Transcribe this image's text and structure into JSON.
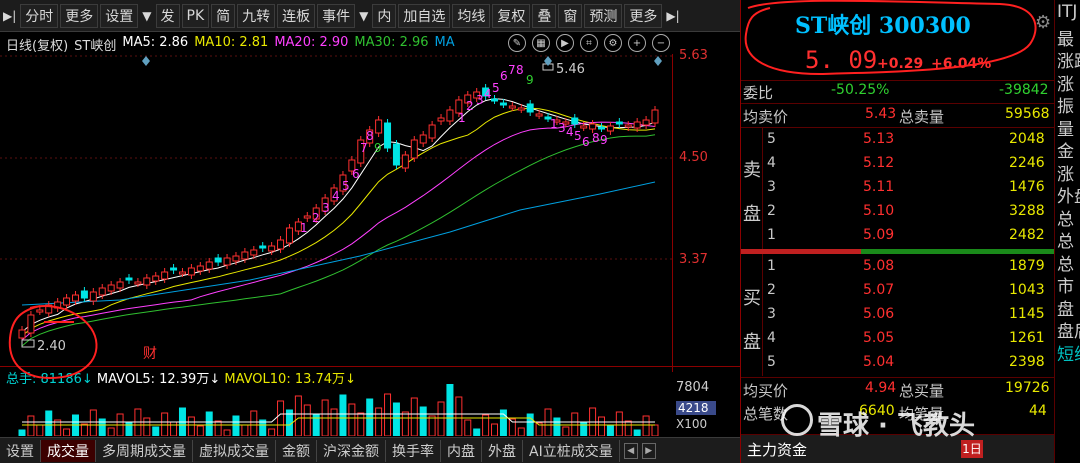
{
  "toolbar": {
    "items": [
      "分时",
      "更多",
      "设置",
      "发",
      "PK",
      "简",
      "九转",
      "连板",
      "事件",
      "内",
      "加自选",
      "均线",
      "复权",
      "叠",
      "窗",
      "预测",
      "更多"
    ]
  },
  "chart_header": {
    "period": "日线(复权)",
    "name": "ST峡创",
    "ma5": "MA5: 2.86",
    "ma10": "MA10: 2.81",
    "ma20": "MA20: 2.90",
    "ma30": "MA30: 2.96",
    "ma_more": "MA"
  },
  "price_axis": {
    "top": "5.63",
    "mid": "4.50",
    "low": "3.37"
  },
  "annotations": {
    "high": "5.46",
    "low": "2.40",
    "event": "财"
  },
  "volume": {
    "label": "总手: 81186",
    "mavol5": "MAVOL5: 12.39万",
    "mavol10": "MAVOL10: 13.74万",
    "axis_top": "7804",
    "axis_mid": "4218",
    "axis_unit": "X100"
  },
  "bottom_tabs": [
    "设置",
    "成交量",
    "多周期成交量",
    "虚拟成交量",
    "金额",
    "沪深金额",
    "换手率",
    "内盘",
    "外盘",
    "AI立桩成交量"
  ],
  "quote": {
    "title": "ST峡创 300300",
    "price": "5. 09",
    "change": "+0.29",
    "pct": "+6.04%",
    "weibi_label": "委比",
    "weibi_val": "-50.25%",
    "weicha_val": "-39842",
    "avg_sell_label": "均卖价",
    "avg_sell_val": "5.43",
    "total_sell_label": "总卖量",
    "total_sell_val": "59568",
    "avg_buy_label": "均买价",
    "avg_buy_val": "4.94",
    "total_buy_label": "总买量",
    "total_buy_val": "19726",
    "trades_label": "总笔数",
    "trades_val": "6640",
    "trades_vol_label": "均笔量",
    "trades_vol_val": "44",
    "sell_side": "卖盘",
    "buy_side": "买盘",
    "fund_label": "主力资金",
    "fund_btn": "1日"
  },
  "asks": [
    {
      "level": "5",
      "price": "5.13",
      "vol": "2048"
    },
    {
      "level": "4",
      "price": "5.12",
      "vol": "2246"
    },
    {
      "level": "3",
      "price": "5.11",
      "vol": "1476"
    },
    {
      "level": "2",
      "price": "5.10",
      "vol": "3288"
    },
    {
      "level": "1",
      "price": "5.09",
      "vol": "2482"
    }
  ],
  "bids": [
    {
      "level": "1",
      "price": "5.08",
      "vol": "1879"
    },
    {
      "level": "2",
      "price": "5.07",
      "vol": "1043"
    },
    {
      "level": "3",
      "price": "5.06",
      "vol": "1145"
    },
    {
      "level": "4",
      "price": "5.05",
      "vol": "1261"
    },
    {
      "level": "5",
      "price": "5.04",
      "vol": "2398"
    }
  ],
  "watermark": "雪球 · 飞教头",
  "far_right": [
    "ITJ",
    "最",
    "涨跌",
    "涨",
    "振",
    "量",
    "金",
    "涨",
    "外盘",
    "总",
    "总",
    "总",
    "市",
    "盘",
    "盘后",
    "短线"
  ],
  "colors": {
    "up": "#ff3030",
    "down": "#00e5e5",
    "ma5": "#ffffff",
    "ma10": "#e8e800",
    "ma20": "#ff40ff",
    "ma30": "#30c030",
    "ma60": "#00a0e0"
  }
}
